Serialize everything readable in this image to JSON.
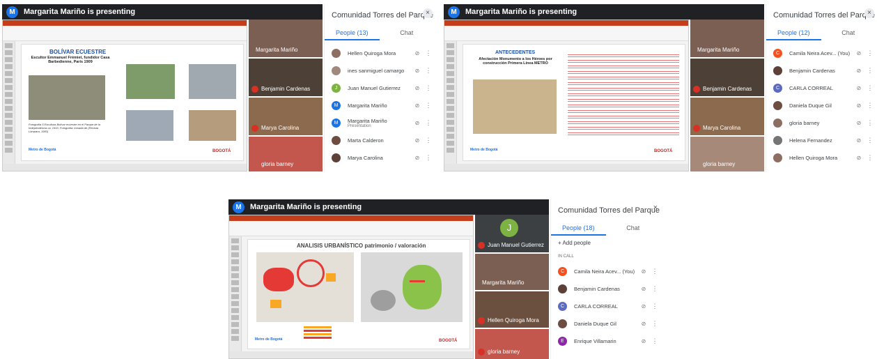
{
  "presenter_banner": "Margarita Mariño is presenting",
  "avatar_letter": "M",
  "meeting_title_1": "Comunidad Torres del Parque - B...",
  "meeting_title_2": "Comunidad Torres del Parque - B...",
  "meeting_title_3": "Comunidad Torres del Parque - B...",
  "close_glyph": "×",
  "slides": {
    "s1_title": "BOLÍVAR ECUESTRE",
    "s1_subtitle": "Escultor Emmanuel Frémiet, fundidor Casa Barbedienne, París 1909",
    "s1_caption": "Fotografía 5 Escultura Bolívar ecuestre en el Parque de la Independencia ca. 1910. Fotografía: tomada de (Revista Lámpara, 1983)",
    "s2_title": "ANTECEDENTES",
    "s2_subtitle": "Afectación Monumento a los Héroes por construcción Primera Línea METRO",
    "s3_title": "ANALISIS URBANÍSTICO patrimonio / valoración",
    "logo_metro": "Metro de Bogotá",
    "logo_bogota": "BOGOTÁ"
  },
  "panel1": {
    "people_tab": "People (13)",
    "chat_tab": "Chat",
    "tiles": [
      "Margarita Mariño",
      "Benjamin Cardenas",
      "Marya Carolina",
      "gloria barney"
    ],
    "people": [
      {
        "name": "Hellen Quiroga Mora",
        "color": "#8d6e63",
        "sub": ""
      },
      {
        "name": "ines sanmiguel camargo",
        "color": "#a1887f",
        "sub": ""
      },
      {
        "name": "Juan Manuel Gutierrez",
        "color": "#7cb342",
        "letter": "J",
        "sub": ""
      },
      {
        "name": "Margarita Mariño",
        "color": "#1a73e8",
        "letter": "M",
        "sub": ""
      },
      {
        "name": "Margarita Mariño",
        "color": "#1a73e8",
        "letter": "M",
        "sub": "Presentation"
      },
      {
        "name": "Marta Calderon",
        "color": "#6d4c41",
        "sub": ""
      },
      {
        "name": "Marya Carolina",
        "color": "#5d4037",
        "sub": ""
      }
    ]
  },
  "panel2": {
    "people_tab": "People (12)",
    "chat_tab": "Chat",
    "tiles": [
      "Margarita Mariño",
      "Benjamin Cardenas",
      "Marya Carolina",
      "gloria barney"
    ],
    "people": [
      {
        "name": "Camila Neira Acev... (You)",
        "color": "#f4511e",
        "letter": "C",
        "sub": ""
      },
      {
        "name": "Benjamin Cardenas",
        "color": "#5d4037",
        "sub": ""
      },
      {
        "name": "CARLA CORREAL",
        "color": "#5c6bc0",
        "letter": "C",
        "sub": ""
      },
      {
        "name": "Daniela Duque Gil",
        "color": "#6d4c41",
        "sub": ""
      },
      {
        "name": "gloria barney",
        "color": "#8d6e63",
        "sub": ""
      },
      {
        "name": "Helena Fernandez",
        "color": "#757575",
        "sub": ""
      },
      {
        "name": "Hellen Quiroga Mora",
        "color": "#8d6e63",
        "sub": ""
      }
    ]
  },
  "panel3": {
    "people_tab": "People (18)",
    "chat_tab": "Chat",
    "add_people": "Add people",
    "in_call": "IN CALL",
    "tiles": [
      "Juan Manuel Gutierrez",
      "Margarita Mariño",
      "Hellen Quiroga Mora",
      "gloria barney"
    ],
    "tile_letter": "J",
    "people": [
      {
        "name": "Camila Neira Acev... (You)",
        "color": "#f4511e",
        "letter": "C",
        "sub": ""
      },
      {
        "name": "Benjamin Cardenas",
        "color": "#5d4037",
        "sub": ""
      },
      {
        "name": "CARLA CORREAL",
        "color": "#5c6bc0",
        "letter": "C",
        "sub": ""
      },
      {
        "name": "Daniela Duque Gil",
        "color": "#6d4c41",
        "sub": ""
      },
      {
        "name": "Enrique Villamarin",
        "color": "#8e24aa",
        "letter": "E",
        "sub": ""
      }
    ]
  }
}
